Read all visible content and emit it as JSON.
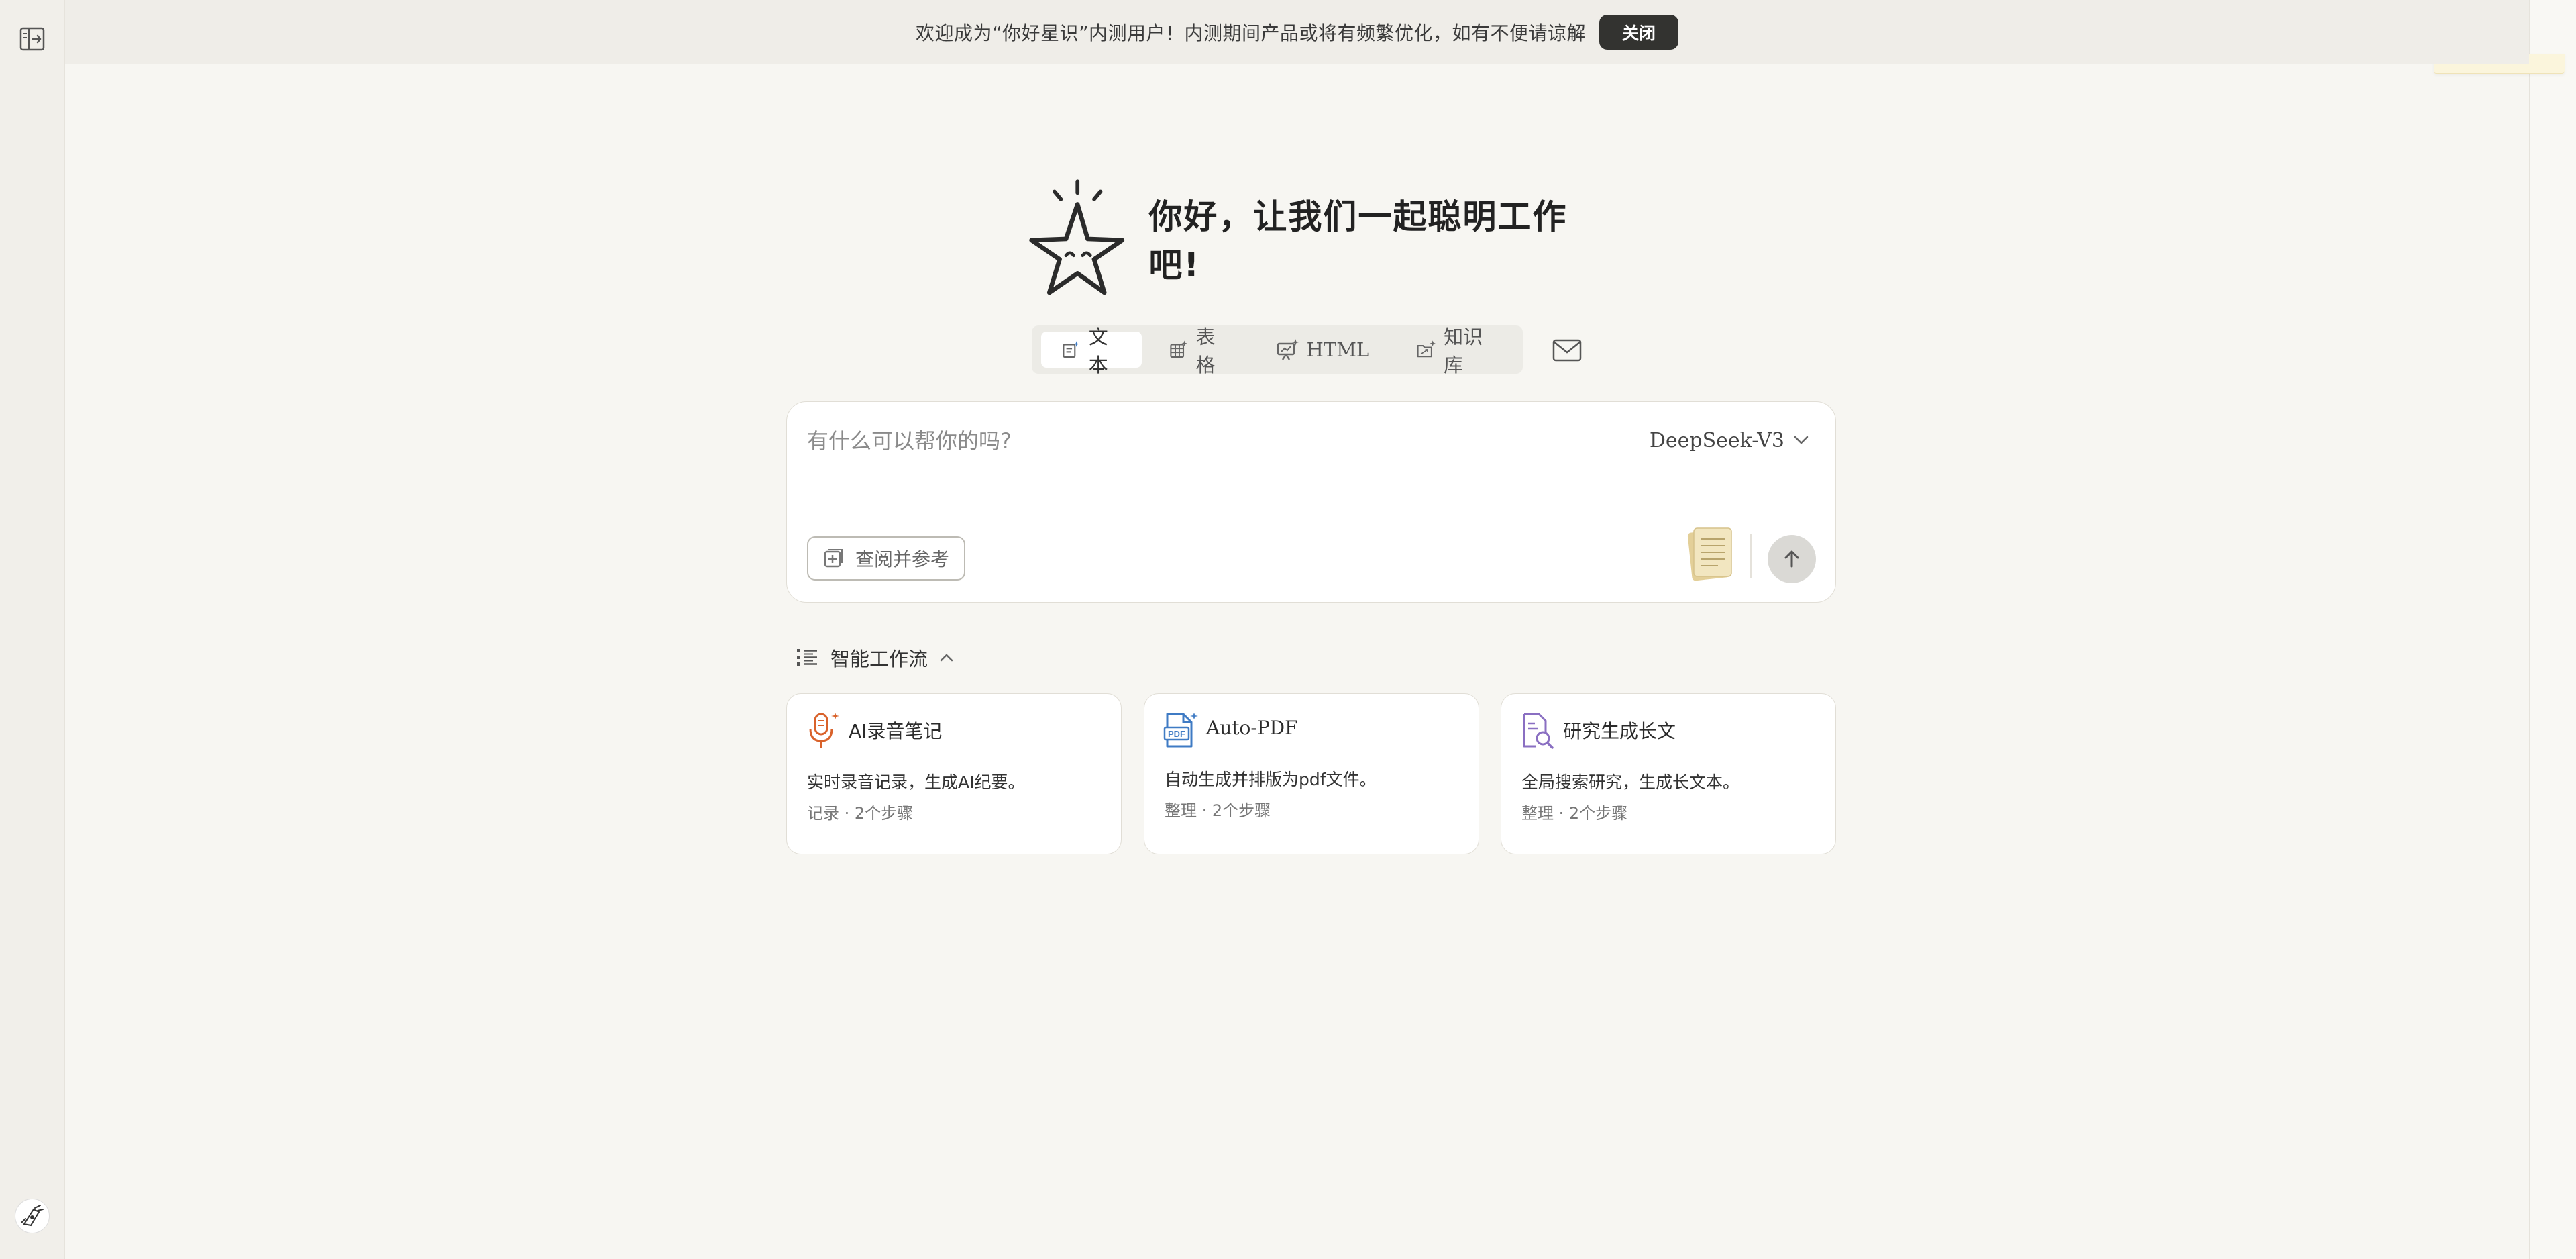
{
  "banner": {
    "message": "欢迎成为“你好星识”内测用户！内测期间产品或将有频繁优化，如有不便请谅解",
    "close_label": "关闭"
  },
  "hero": {
    "title": "你好，让我们一起聪明工作吧!"
  },
  "modes": [
    {
      "label": "文本",
      "icon": "text-sparkle-icon",
      "active": true
    },
    {
      "label": "表格",
      "icon": "table-sparkle-icon",
      "active": false
    },
    {
      "label": "HTML",
      "icon": "presentation-sparkle-icon",
      "active": false
    },
    {
      "label": "知识库",
      "icon": "folder-sparkle-icon",
      "active": false
    }
  ],
  "input": {
    "placeholder": "有什么可以帮你的吗?",
    "value": "",
    "model": "DeepSeek-V3",
    "reference_label": "查阅并参考"
  },
  "workflows": {
    "title": "智能工作流",
    "cards": [
      {
        "name": "AI录音笔记",
        "desc": "实时录音记录，生成AI纪要。",
        "meta": "记录 · 2个步骤",
        "icon": "microphone-icon"
      },
      {
        "name": "Auto-PDF",
        "desc": "自动生成并排版为pdf文件。",
        "meta": "整理 · 2个步骤",
        "icon": "pdf-icon"
      },
      {
        "name": "研究生成长文",
        "desc": "全局搜索研究，生成长文本。",
        "meta": "整理 · 2个步骤",
        "icon": "document-search-icon"
      }
    ]
  },
  "colors": {
    "background": "#f7f6f2",
    "banner": "#efede8",
    "close_button": "#333330",
    "card_border": "#e1ded6",
    "mic_accent": "#d9622b",
    "pdf_accent": "#3f7bc4",
    "research_accent": "#8a6fc2"
  }
}
